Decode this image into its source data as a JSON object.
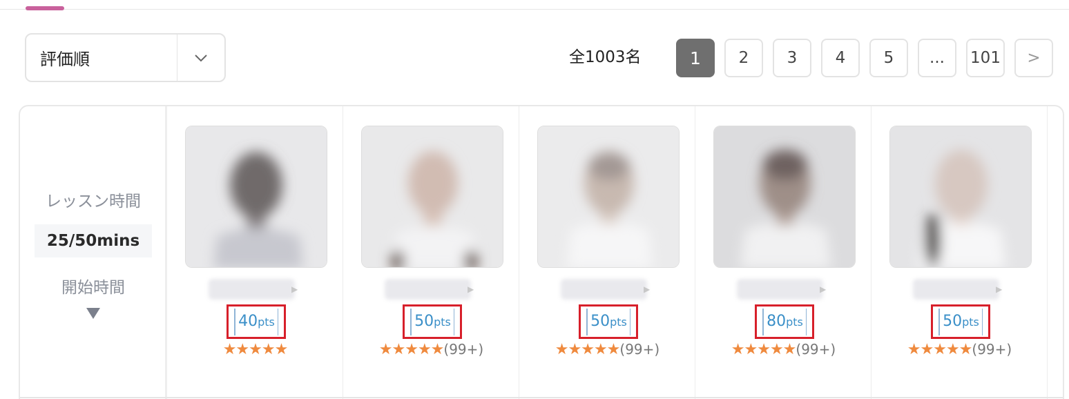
{
  "sort": {
    "selected": "評価順"
  },
  "summary": {
    "total": "全1003名"
  },
  "pagination": {
    "pages": [
      "1",
      "2",
      "3",
      "4",
      "5",
      "...",
      "101"
    ],
    "next": ">",
    "active": "1"
  },
  "filters": {
    "lesson_time_label": "レッスン時間",
    "lesson_duration": "25/50mins",
    "start_time_label": "開始時間"
  },
  "tutors": [
    {
      "points": "40",
      "unit": "pts",
      "stars": "★★★★★",
      "reviews": ""
    },
    {
      "points": "50",
      "unit": "pts",
      "stars": "★★★★★",
      "reviews": "(99+)"
    },
    {
      "points": "50",
      "unit": "pts",
      "stars": "★★★★★",
      "reviews": "(99+)"
    },
    {
      "points": "80",
      "unit": "pts",
      "stars": "★★★★★",
      "reviews": "(99+)"
    },
    {
      "points": "50",
      "unit": "pts",
      "stars": "★★★★★",
      "reviews": "(99+)"
    }
  ],
  "colors": {
    "accent": "#c9619c",
    "active_page": "#6f6f6f",
    "points_text": "#3a8fc8",
    "highlight_box": "#d71f2a",
    "stars": "#ef8a3e"
  }
}
